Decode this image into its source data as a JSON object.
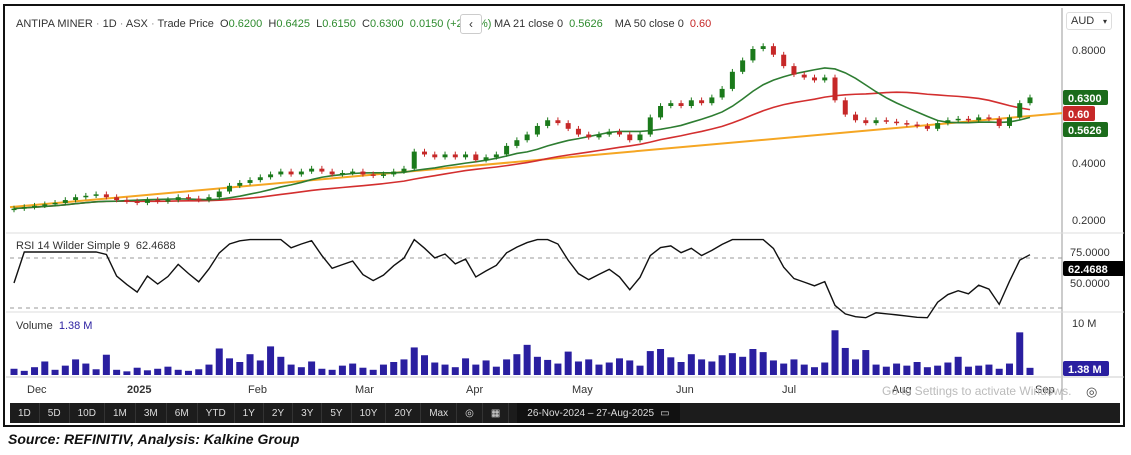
{
  "header": {
    "symbol": "ANTIPA MINER",
    "interval": "1D",
    "exchange": "ASX",
    "price_type": "Trade Price",
    "open_label": "O",
    "open": "0.6200",
    "high_label": "H",
    "high": "0.6425",
    "low_label": "L",
    "low": "0.6150",
    "close_label": "C",
    "close": "0.6300",
    "change": "0.0150 (+2.44%)",
    "ma21_label": "MA 21 close 0",
    "ma21_value": "0.5626",
    "ma50_label": "MA 50 close 0",
    "ma50_value": "0.60",
    "currency": "AUD"
  },
  "rsi": {
    "label": "RSI 14 Wilder Simple 9",
    "value": "62.4688",
    "axis": [
      "75.0000",
      "50.0000"
    ]
  },
  "volume": {
    "label": "Volume",
    "value": "1.38 M",
    "axis_top": "10 M",
    "badge": "1.38 M"
  },
  "price_axis": {
    "ticks": [
      "0.8000",
      "0.4000",
      "0.2000"
    ],
    "badge_close": "0.6300",
    "badge_ma50": "0.60",
    "badge_ma21": "0.5626"
  },
  "x_axis": {
    "labels": [
      "Dec",
      "2025",
      "Feb",
      "Mar",
      "Apr",
      "May",
      "Jun",
      "Jul",
      "Aug",
      "Sep"
    ]
  },
  "toolbar": {
    "ranges": [
      "1D",
      "5D",
      "10D",
      "1M",
      "3M",
      "6M",
      "YTD",
      "1Y",
      "2Y",
      "3Y",
      "5Y",
      "10Y",
      "20Y",
      "Max"
    ],
    "date_range": "26-Nov-2024  –  27-Aug-2025"
  },
  "watermark": "Go to Settings to activate Windows.",
  "source": "Source: REFINITIV, Analysis: Kalkine Group",
  "colors": {
    "up": "#1b7a1b",
    "down": "#c62828",
    "ma21": "#2e7d32",
    "ma50": "#d32f2f",
    "trend": "#f5a623",
    "volume": "#2a1fa0",
    "rsi": "#111111"
  },
  "chart_data": {
    "type": "candlestick",
    "title": "ANTIPA MINER · 1D · ASX",
    "x_range": [
      "26-Nov-2024",
      "27-Aug-2025"
    ],
    "ylim": [
      0.2,
      0.85
    ],
    "close": [
      0.24,
      0.245,
      0.25,
      0.255,
      0.26,
      0.27,
      0.28,
      0.285,
      0.29,
      0.28,
      0.27,
      0.265,
      0.26,
      0.27,
      0.265,
      0.27,
      0.28,
      0.275,
      0.27,
      0.28,
      0.3,
      0.32,
      0.33,
      0.34,
      0.35,
      0.36,
      0.37,
      0.36,
      0.37,
      0.38,
      0.37,
      0.36,
      0.365,
      0.37,
      0.36,
      0.355,
      0.36,
      0.37,
      0.38,
      0.44,
      0.43,
      0.42,
      0.43,
      0.42,
      0.43,
      0.41,
      0.42,
      0.43,
      0.46,
      0.48,
      0.5,
      0.53,
      0.55,
      0.54,
      0.52,
      0.5,
      0.49,
      0.5,
      0.51,
      0.5,
      0.48,
      0.5,
      0.56,
      0.6,
      0.61,
      0.6,
      0.62,
      0.61,
      0.63,
      0.66,
      0.72,
      0.76,
      0.8,
      0.81,
      0.78,
      0.74,
      0.71,
      0.7,
      0.69,
      0.7,
      0.62,
      0.57,
      0.55,
      0.54,
      0.55,
      0.545,
      0.54,
      0.535,
      0.53,
      0.52,
      0.54,
      0.55,
      0.555,
      0.55,
      0.56,
      0.555,
      0.53,
      0.56,
      0.61,
      0.63
    ],
    "wick": 0.01,
    "trendline": [
      0.245,
      0.575
    ],
    "volume_millions": [
      1.2,
      0.8,
      1.5,
      2.6,
      1.0,
      1.8,
      3.0,
      2.2,
      1.1,
      3.9,
      1.0,
      0.7,
      1.4,
      0.9,
      1.2,
      1.6,
      1.0,
      0.8,
      1.1,
      2.0,
      5.1,
      3.2,
      2.5,
      4.0,
      2.8,
      5.5,
      3.5,
      2.0,
      1.5,
      2.6,
      1.2,
      1.0,
      1.8,
      2.2,
      1.4,
      1.0,
      2.0,
      2.5,
      3.0,
      5.3,
      3.8,
      2.4,
      2.0,
      1.5,
      3.2,
      2.0,
      2.8,
      1.6,
      3.0,
      4.0,
      5.8,
      3.5,
      2.9,
      2.2,
      4.5,
      2.6,
      3.0,
      2.0,
      2.4,
      3.2,
      2.8,
      1.8,
      4.6,
      5.0,
      3.4,
      2.5,
      4.0,
      3.0,
      2.6,
      3.8,
      4.2,
      3.5,
      5.0,
      4.4,
      2.8,
      2.2,
      3.0,
      2.0,
      1.5,
      2.4,
      8.6,
      5.2,
      3.0,
      4.8,
      2.0,
      1.6,
      2.2,
      1.8,
      2.5,
      1.5,
      1.8,
      2.4,
      3.5,
      1.6,
      1.8,
      2.0,
      1.2,
      2.2,
      8.2,
      1.38
    ],
    "volume_max": 10,
    "rsi_levels": [
      70,
      30
    ]
  }
}
